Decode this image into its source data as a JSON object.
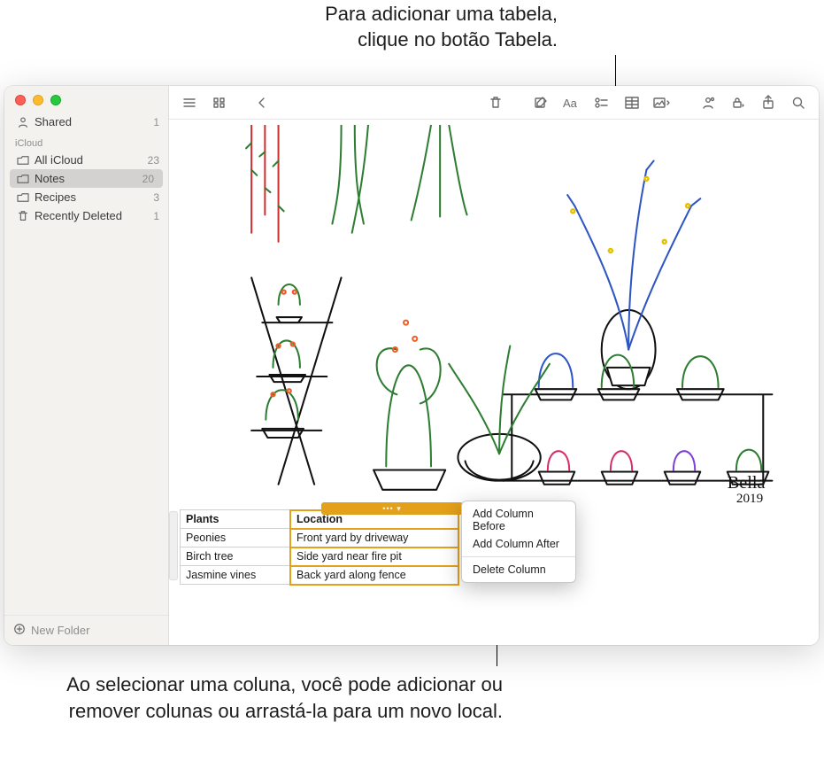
{
  "callouts": {
    "top": "Para adicionar uma tabela, clique no botão Tabela.",
    "bottom": "Ao selecionar uma coluna, você pode adicionar ou remover colunas ou arrastá-la para um novo local."
  },
  "sidebar": {
    "shared": {
      "label": "Shared",
      "count": "1"
    },
    "section_head": "iCloud",
    "items": [
      {
        "label": "All iCloud",
        "count": "23",
        "selected": false,
        "kind": "folder"
      },
      {
        "label": "Notes",
        "count": "20",
        "selected": true,
        "kind": "folder"
      },
      {
        "label": "Recipes",
        "count": "3",
        "selected": false,
        "kind": "folder"
      },
      {
        "label": "Recently Deleted",
        "count": "1",
        "selected": false,
        "kind": "trash"
      }
    ],
    "footer": "New Folder"
  },
  "toolbar": {
    "names": [
      "view-list",
      "view-grid",
      "back",
      "delete",
      "compose",
      "text-style",
      "checklist",
      "table",
      "media",
      "collaborate",
      "lock",
      "share",
      "search"
    ]
  },
  "drawing": {
    "signature": "Bella",
    "signature_year": "2019"
  },
  "table": {
    "headers": [
      "Plants",
      "Location"
    ],
    "rows": [
      [
        "Peonies",
        "Front yard by driveway"
      ],
      [
        "Birch tree",
        "Side yard near fire pit"
      ],
      [
        "Jasmine vines",
        "Back yard along fence"
      ]
    ],
    "selected_column_index": 1
  },
  "context_menu": {
    "items_top": [
      "Add Column Before",
      "Add Column After"
    ],
    "items_bottom": [
      "Delete Column"
    ]
  },
  "colors": {
    "selection_orange": "#e3a01b"
  }
}
